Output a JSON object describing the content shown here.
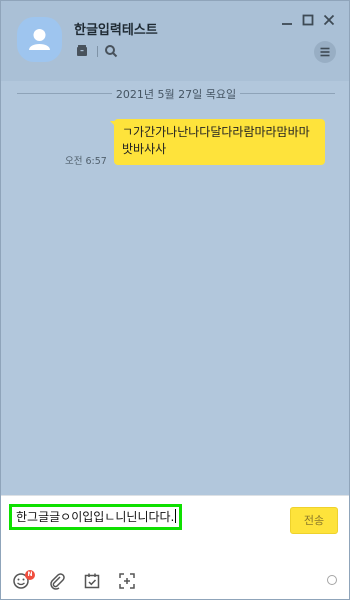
{
  "window": {
    "title": "한글입력테스트"
  },
  "chat": {
    "date_separator": "2021년 5월 27일 목요일",
    "messages": [
      {
        "time": "오전 6:57",
        "text": "ㄱ가간가나난나다달다라람마라맘바마밧바사사"
      }
    ]
  },
  "composer": {
    "input_value": "한그글글ㅇ이입입ㄴ니닌니다다.",
    "send_label": "전송",
    "emoji_badge": "N"
  },
  "colors": {
    "accent": "#fee33b",
    "background": "#b2c7dc",
    "focus_outline": "#0ee000",
    "badge": "#f04e3e"
  },
  "icons": [
    "person-icon",
    "folder-icon",
    "search-icon",
    "minimize-icon",
    "maximize-icon",
    "close-icon",
    "menu-icon",
    "emoji-icon",
    "attach-icon",
    "calendar-check-icon",
    "capture-icon",
    "option-circle-icon"
  ]
}
